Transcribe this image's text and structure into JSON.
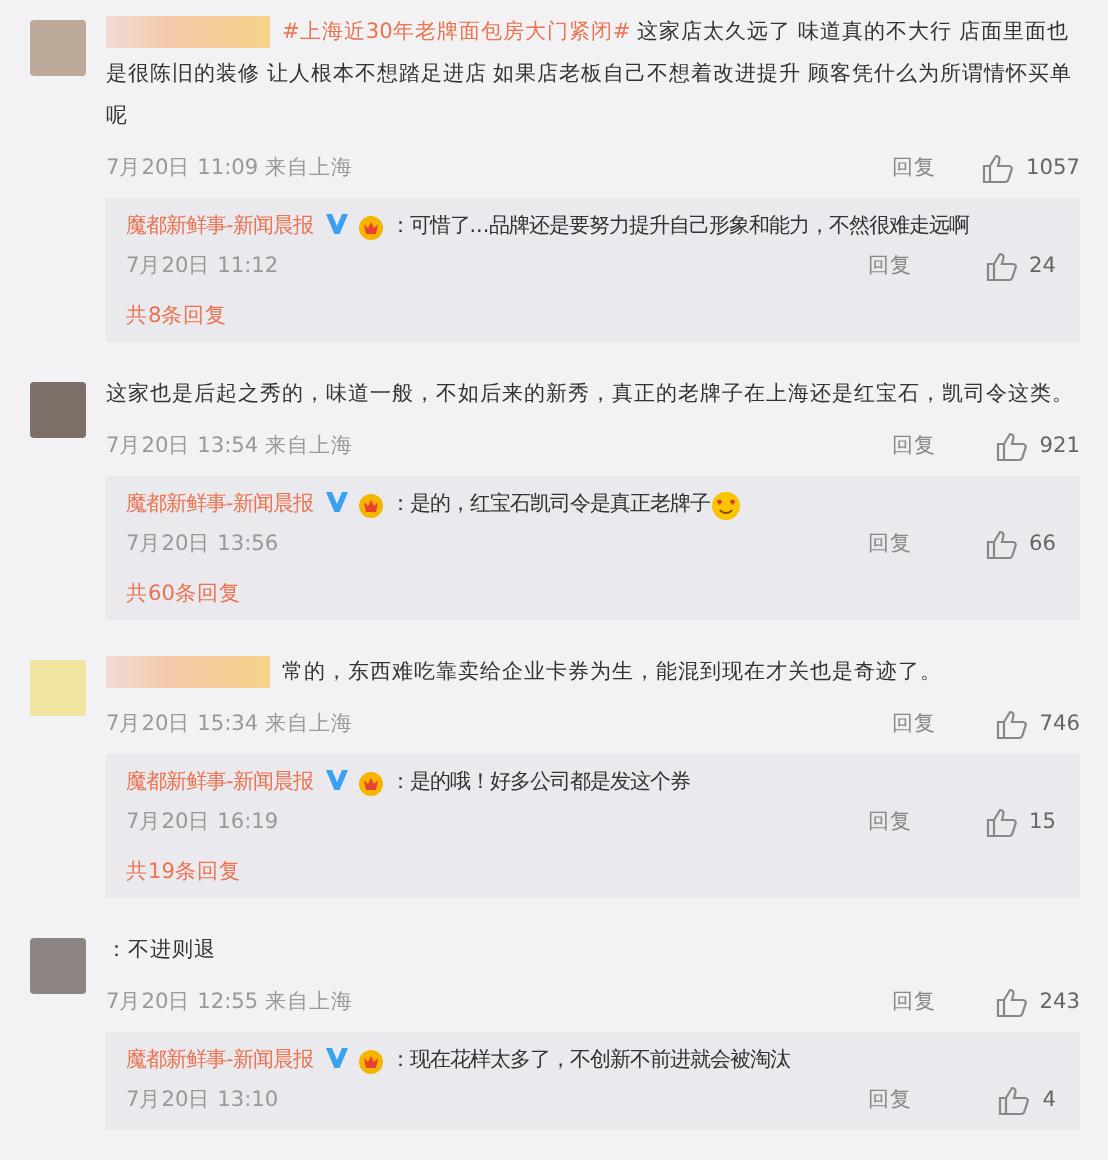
{
  "comments": [
    {
      "redacted": true,
      "hashtag": "#上海近30年老牌面包房大门紧闭#",
      "text": " 这家店太久远了 味道真的不大行 店面里面也是很陈旧的装修 让人根本不想踏足进店 如果店老板自己不想着改进提升 顾客凭什么为所谓情怀买单呢",
      "time": "7月20日 11:09 来自上海",
      "reply_label": "回复",
      "likes": "1057",
      "reply": {
        "author": "魔都新鲜事-新闻晨报",
        "text": "：可惜了...品牌还是要努力提升自己形象和能力，不然很难走远啊",
        "emoji": false,
        "time": "7月20日 11:12",
        "reply_label": "回复",
        "likes": "24"
      },
      "more": "共8条回复"
    },
    {
      "redacted": false,
      "text": "这家也是后起之秀的，味道一般，不如后来的新秀，真正的老牌子在上海还是红宝石，凯司令这类。",
      "time": "7月20日 13:54 来自上海",
      "reply_label": "回复",
      "likes": "921",
      "reply": {
        "author": "魔都新鲜事-新闻晨报",
        "text": "：是的，红宝石凯司令是真正老牌子",
        "emoji": true,
        "time": "7月20日 13:56",
        "reply_label": "回复",
        "likes": "66"
      },
      "more": "共60条回复"
    },
    {
      "redacted": true,
      "text": "常的，东西难吃靠卖给企业卡券为生，能混到现在才关也是奇迹了。",
      "time": "7月20日 15:34 来自上海",
      "reply_label": "回复",
      "likes": "746",
      "reply": {
        "author": "魔都新鲜事-新闻晨报",
        "text": "：是的哦！好多公司都是发这个券",
        "emoji": false,
        "time": "7月20日 16:19",
        "reply_label": "回复",
        "likes": "15"
      },
      "more": "共19条回复"
    },
    {
      "redacted": false,
      "text": "：不进则退",
      "time": "7月20日 12:55 来自上海",
      "reply_label": "回复",
      "likes": "243",
      "reply": {
        "author": "魔都新鲜事-新闻晨报",
        "text": "：现在花样太多了，不创新不前进就会被淘汰",
        "emoji": false,
        "time": "7月20日 13:10",
        "reply_label": "回复",
        "likes": "4"
      }
    }
  ]
}
